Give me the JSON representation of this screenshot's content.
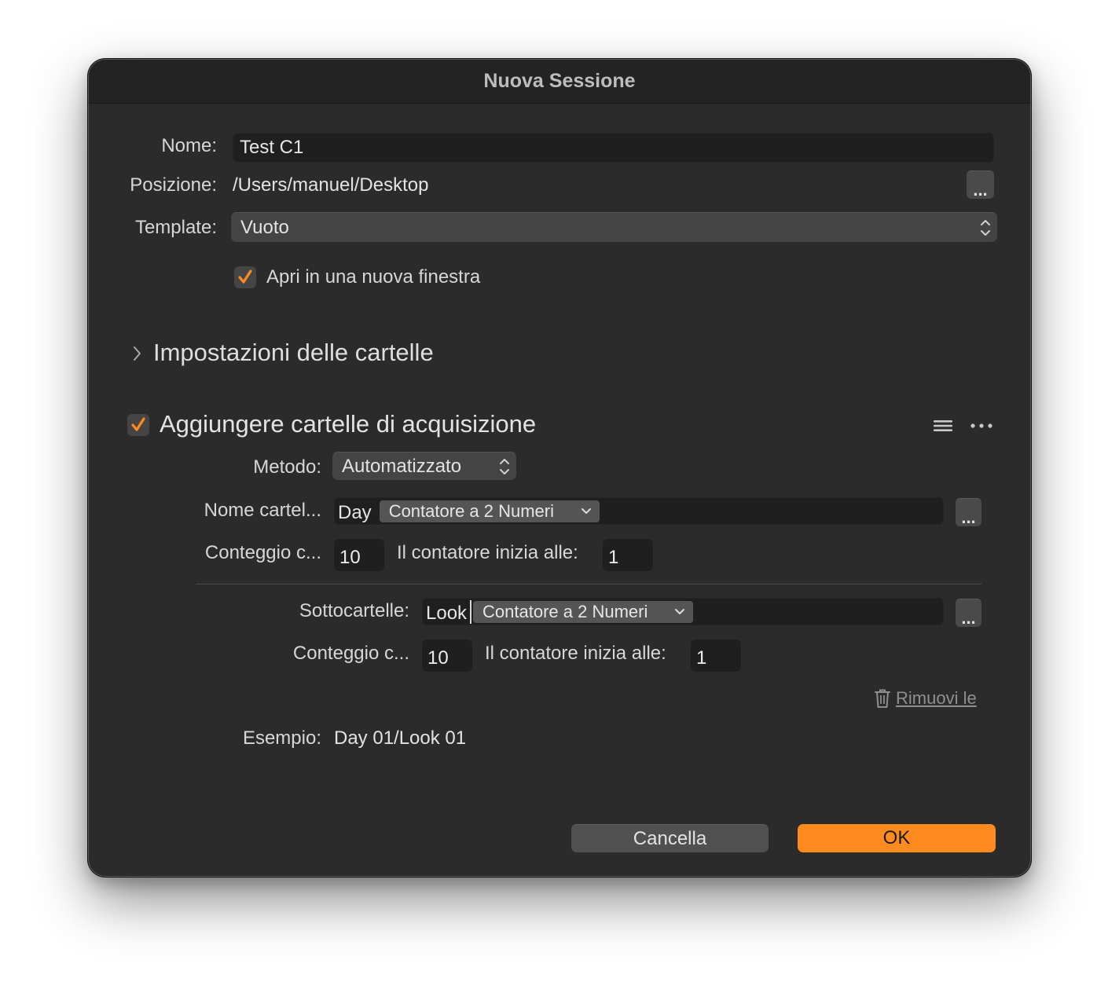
{
  "window": {
    "title": "Nuova Sessione"
  },
  "form": {
    "name_label": "Nome:",
    "name_value": "Test C1",
    "location_label": "Posizione:",
    "location_value": "/Users/manuel/Desktop",
    "location_browse_label": "...",
    "template_label": "Template:",
    "template_value": "Vuoto",
    "open_new_window_label": "Apri in una nuova finestra",
    "open_new_window_checked": true
  },
  "folder_settings": {
    "title": "Impostazioni delle cartelle",
    "expanded": false
  },
  "capture_folders": {
    "title": "Aggiungere cartelle di acquisizione",
    "enabled": true,
    "method_label": "Metodo:",
    "method_value": "Automatizzato",
    "folder_name_label": "Nome cartel...",
    "folder_name_prefix": "Day",
    "folder_name_token": "Contatore a 2 Numeri",
    "folder_name_browse": "...",
    "count_label": "Conteggio c...",
    "count_value": "10",
    "counter_start_label": "Il contatore inizia alle:",
    "counter_start_value": "1",
    "subfolders_label": "Sottocartelle:",
    "subfolder_prefix": "Look",
    "subfolder_token": "Contatore a 2 Numeri",
    "subfolder_browse": "...",
    "sub_count_label": "Conteggio c...",
    "sub_count_value": "10",
    "sub_counter_start_label": "Il contatore inizia alle:",
    "sub_counter_start_value": "1",
    "remove_label": "Rimuovi le",
    "example_label": "Esempio:",
    "example_value": "Day 01/Look 01"
  },
  "buttons": {
    "cancel": "Cancella",
    "ok": "OK"
  },
  "colors": {
    "accent": "#ff8a1d",
    "window_bg": "#2b2b2b",
    "field_bg": "#1f1f1f"
  }
}
